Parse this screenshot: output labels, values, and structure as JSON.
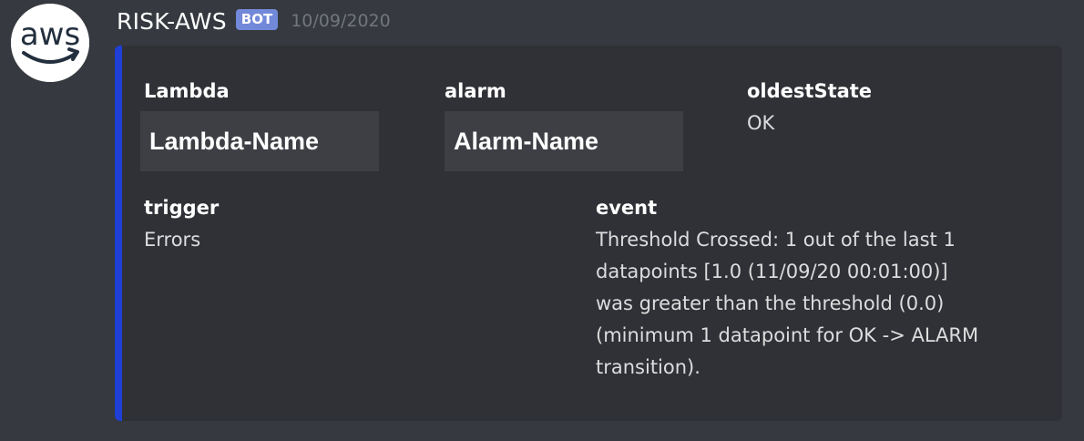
{
  "message": {
    "author": "RISK-AWS",
    "tag": "BOT",
    "timestamp": "10/09/2020",
    "avatar_text": "aws"
  },
  "embed": {
    "accent_color": "#1f3fd6",
    "fields": [
      {
        "name": "Lambda",
        "value": "Lambda-Name"
      },
      {
        "name": "alarm",
        "value": "Alarm-Name"
      },
      {
        "name": "oldestState",
        "value": "OK"
      },
      {
        "name": "trigger",
        "value": "Errors"
      },
      {
        "name": "event",
        "value_lines": [
          "Threshold Crossed: 1 out of the last 1",
          "datapoints [1.0 (11/09/20 00:01:00)]",
          "was greater than the threshold (0.0)",
          "(minimum 1 datapoint for OK -> ALARM",
          "transition)."
        ]
      }
    ]
  }
}
